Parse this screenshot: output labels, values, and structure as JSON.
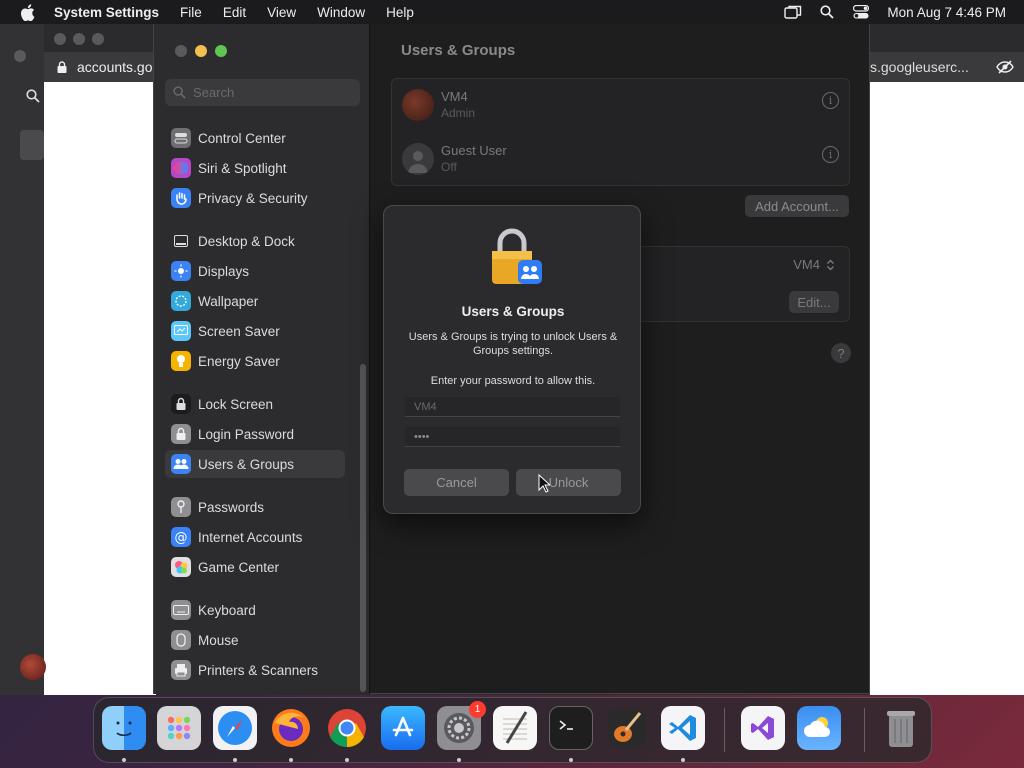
{
  "menubar": {
    "app_name": "System Settings",
    "items": [
      "File",
      "Edit",
      "View",
      "Window",
      "Help"
    ],
    "clock": "Mon Aug 7  4:46 PM"
  },
  "browser": {
    "url_left": "accounts.go",
    "url_right": "s.googleuserc..."
  },
  "settings": {
    "search_placeholder": "Search",
    "sidebar": [
      {
        "label": "Control Center",
        "icon": "control-center-icon",
        "color": "#6e6e73"
      },
      {
        "label": "Siri & Spotlight",
        "icon": "siri-icon",
        "color": "#b548c6"
      },
      {
        "label": "Privacy & Security",
        "icon": "hand-icon",
        "color": "#3b82f6"
      },
      {
        "label": "Desktop & Dock",
        "icon": "dock-icon",
        "color": "#2c2c2e"
      },
      {
        "label": "Displays",
        "icon": "sun-icon",
        "color": "#3b82f6"
      },
      {
        "label": "Wallpaper",
        "icon": "wallpaper-icon",
        "color": "#34aadc"
      },
      {
        "label": "Screen Saver",
        "icon": "screen-saver-icon",
        "color": "#5ac8fa"
      },
      {
        "label": "Energy Saver",
        "icon": "bulb-icon",
        "color": "#f5b400"
      },
      {
        "label": "Lock Screen",
        "icon": "lock-icon",
        "color": "#1c1c1e"
      },
      {
        "label": "Login Password",
        "icon": "login-icon",
        "color": "#8e8e93"
      },
      {
        "label": "Users & Groups",
        "icon": "users-icon",
        "color": "#3b82f6"
      },
      {
        "label": "Passwords",
        "icon": "key-icon",
        "color": "#8e8e93"
      },
      {
        "label": "Internet Accounts",
        "icon": "at-icon",
        "color": "#3b82f6"
      },
      {
        "label": "Game Center",
        "icon": "game-center-icon",
        "color": "#e0e0e0"
      },
      {
        "label": "Keyboard",
        "icon": "keyboard-icon",
        "color": "#8e8e93"
      },
      {
        "label": "Mouse",
        "icon": "mouse-icon",
        "color": "#8e8e93"
      },
      {
        "label": "Printers & Scanners",
        "icon": "printer-icon",
        "color": "#8e8e93"
      }
    ],
    "page_title": "Users & Groups",
    "users": [
      {
        "name": "VM4",
        "role": "Admin"
      },
      {
        "name": "Guest User",
        "role": "Off"
      }
    ],
    "add_account": "Add Account...",
    "auto_login_value": "VM4",
    "edit_label": "Edit...",
    "help_label": "?"
  },
  "dialog": {
    "title": "Users & Groups",
    "message": "Users & Groups is trying to unlock Users & Groups settings.",
    "prompt": "Enter your password to allow this.",
    "username_value": "VM4",
    "password_value": "••••",
    "cancel": "Cancel",
    "unlock": "Unlock"
  },
  "dock": {
    "apps": [
      {
        "name": "finder"
      },
      {
        "name": "launchpad"
      },
      {
        "name": "safari"
      },
      {
        "name": "firefox"
      },
      {
        "name": "chrome"
      },
      {
        "name": "app-store"
      },
      {
        "name": "system-settings",
        "badge": "1"
      },
      {
        "name": "textedit"
      },
      {
        "name": "terminal"
      },
      {
        "name": "garageband"
      },
      {
        "name": "vscode"
      },
      {
        "name": "visual-studio"
      },
      {
        "name": "weather"
      },
      {
        "name": "trash"
      }
    ]
  }
}
